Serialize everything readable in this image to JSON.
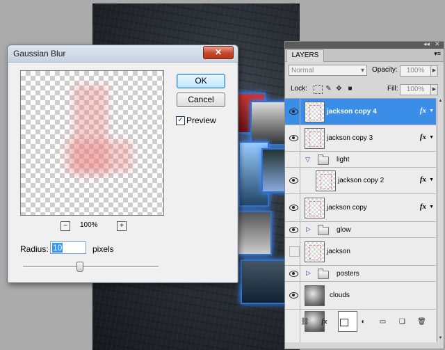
{
  "dialog": {
    "title": "Gaussian Blur",
    "close_glyph": "✕",
    "ok_label": "OK",
    "cancel_label": "Cancel",
    "preview_label": "Preview",
    "preview_checked": true,
    "zoom_out": "−",
    "zoom_level": "100%",
    "zoom_in": "+",
    "radius_label": "Radius:",
    "radius_value": "10",
    "radius_unit": "pixels"
  },
  "layers_panel": {
    "tab": "LAYERS",
    "blend_mode": "Normal",
    "opacity_label": "Opacity:",
    "opacity_value": "100%",
    "lock_label": "Lock:",
    "fill_label": "Fill:",
    "fill_value": "100%",
    "fx_label": "fx",
    "layers": [
      {
        "name": "jackson copy 4",
        "visible": true,
        "selected": true,
        "fx": true
      },
      {
        "name": "jackson copy 3",
        "visible": true,
        "fx": true
      },
      {
        "name": "light",
        "type": "group",
        "expanded": true
      },
      {
        "name": "jackson copy 2",
        "visible": true,
        "fx": true,
        "indent": true
      },
      {
        "name": "jackson copy",
        "visible": true,
        "fx": true
      },
      {
        "name": "glow",
        "type": "group",
        "expanded": false
      },
      {
        "name": "jackson",
        "visible": false
      },
      {
        "name": "posters",
        "visible": true,
        "type": "group",
        "expanded": false
      },
      {
        "name": "clouds",
        "visible": true
      }
    ]
  },
  "colors": {
    "selection": "#3b8ee8",
    "glow": "#3a8cff"
  }
}
